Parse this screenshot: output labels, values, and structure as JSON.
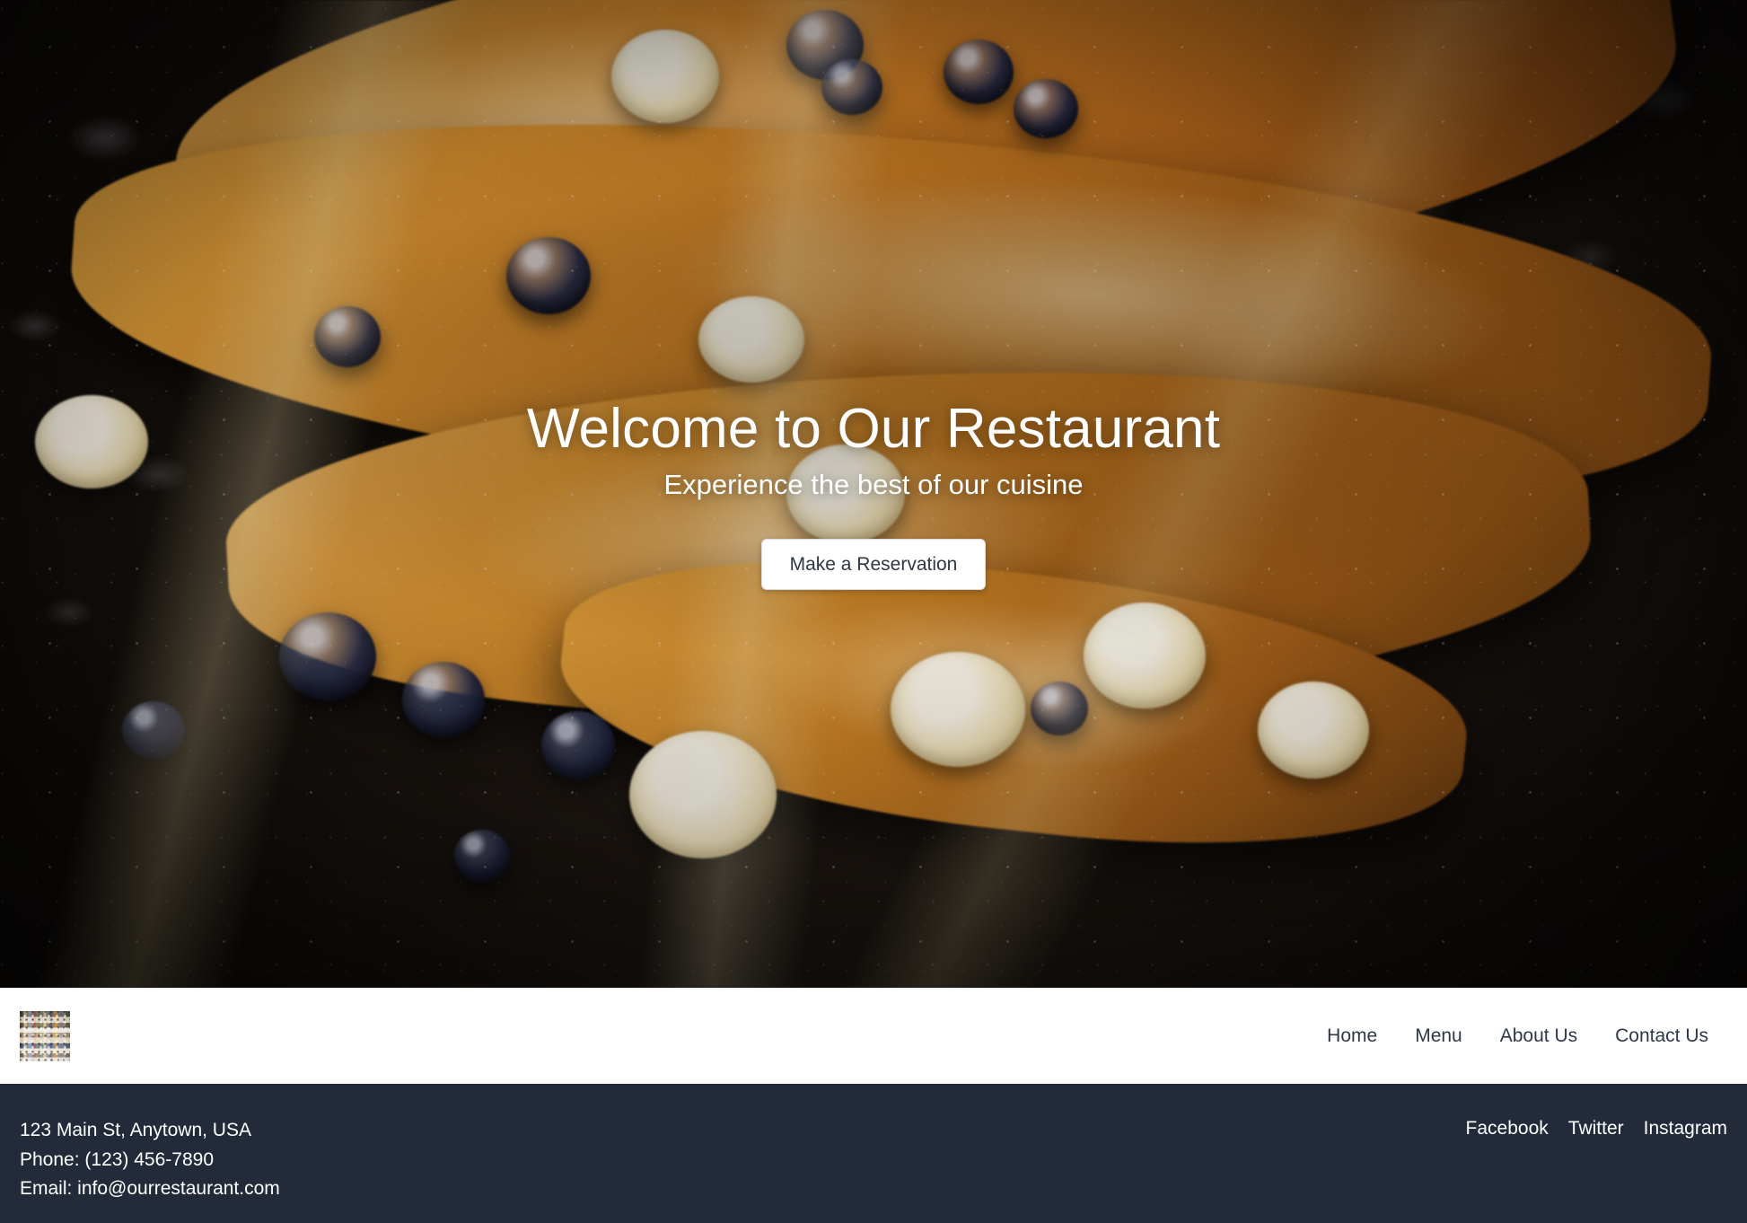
{
  "hero": {
    "title": "Welcome to Our Restaurant",
    "subtitle": "Experience the best of our cuisine",
    "cta_label": "Make a Reservation",
    "background_description": "Close-up photograph of stacked French toast with blueberries, banana slices, honey drizzle and powdered sugar on a dark stone surface",
    "title_color": "#ffffff",
    "cta_bg": "#ffffff",
    "cta_text_color": "#2f3743"
  },
  "navbar": {
    "logo_name": "restaurant-logo",
    "background": "#ffffff",
    "link_color": "#2d3748",
    "links": [
      {
        "label": "Home"
      },
      {
        "label": "Menu"
      },
      {
        "label": "About Us"
      },
      {
        "label": "Contact Us"
      }
    ]
  },
  "footer": {
    "background": "#232b3a",
    "text_color": "#ffffff",
    "address": "123 Main St, Anytown, USA",
    "phone": "Phone: (123) 456-7890",
    "email": "Email: info@ourrestaurant.com",
    "social": [
      {
        "label": "Facebook"
      },
      {
        "label": "Twitter"
      },
      {
        "label": "Instagram"
      }
    ]
  }
}
